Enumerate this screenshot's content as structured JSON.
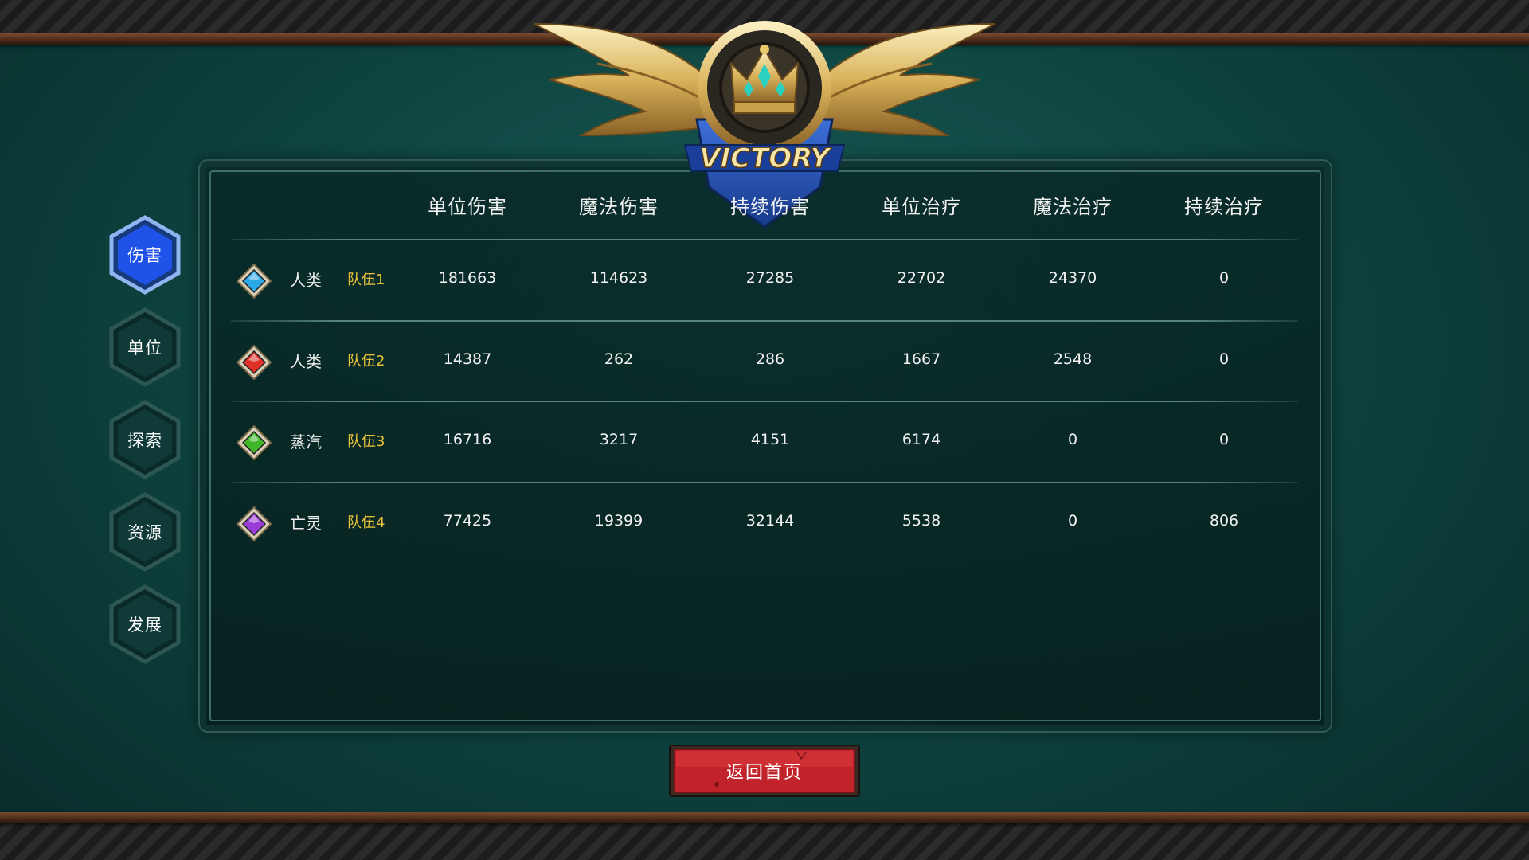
{
  "emblem": {
    "text": "VICTORY"
  },
  "side_nav": [
    {
      "label": "伤害",
      "active": true
    },
    {
      "label": "单位",
      "active": false
    },
    {
      "label": "探索",
      "active": false
    },
    {
      "label": "资源",
      "active": false
    },
    {
      "label": "发展",
      "active": false
    }
  ],
  "table": {
    "columns": [
      "单位伤害",
      "魔法伤害",
      "持续伤害",
      "单位治疗",
      "魔法治疗",
      "持续治疗"
    ],
    "rows": [
      {
        "gem": "blue-gem-icon",
        "gem_color": "#2aa8e8",
        "race": "人类",
        "team": "队伍1",
        "values": [
          "181663",
          "114623",
          "27285",
          "22702",
          "24370",
          "0"
        ]
      },
      {
        "gem": "red-gem-icon",
        "gem_color": "#e0302a",
        "race": "人类",
        "team": "队伍2",
        "values": [
          "14387",
          "262",
          "286",
          "1667",
          "2548",
          "0"
        ]
      },
      {
        "gem": "green-gem-icon",
        "gem_color": "#3fb52a",
        "race": "蒸汽",
        "team": "队伍3",
        "values": [
          "16716",
          "3217",
          "4151",
          "6174",
          "0",
          "0"
        ]
      },
      {
        "gem": "purple-gem-icon",
        "gem_color": "#9a3cd8",
        "race": "亡灵",
        "team": "队伍4",
        "values": [
          "77425",
          "19399",
          "32144",
          "5538",
          "0",
          "806"
        ]
      }
    ]
  },
  "return_button": {
    "label": "返回首页"
  },
  "colors": {
    "accent_team": "#e8c23a",
    "active_tab": "#1f52e8",
    "button_red": "#c0242a"
  }
}
